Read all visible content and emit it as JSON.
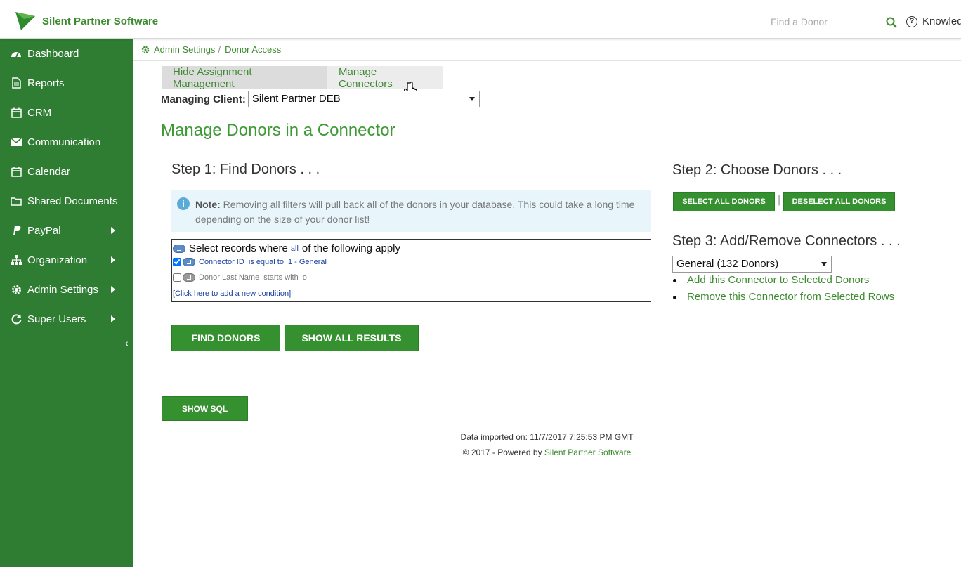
{
  "header": {
    "brand": "Silent Partner Software",
    "search_placeholder": "Find a Donor",
    "knowledge_label": "Knowledge"
  },
  "sidebar": {
    "items": [
      {
        "label": "Dashboard",
        "icon": "dashboard-icon",
        "has_submenu": false
      },
      {
        "label": "Reports",
        "icon": "document-icon",
        "has_submenu": false
      },
      {
        "label": "CRM",
        "icon": "calendar-icon",
        "has_submenu": false
      },
      {
        "label": "Communication",
        "icon": "envelope-icon",
        "has_submenu": false
      },
      {
        "label": "Calendar",
        "icon": "calendar-icon",
        "has_submenu": false
      },
      {
        "label": "Shared Documents",
        "icon": "folder-icon",
        "has_submenu": false
      },
      {
        "label": "PayPal",
        "icon": "paypal-icon",
        "has_submenu": true
      },
      {
        "label": "Organization",
        "icon": "sitemap-icon",
        "has_submenu": true
      },
      {
        "label": "Admin Settings",
        "icon": "gear-icon",
        "has_submenu": true
      },
      {
        "label": "Super Users",
        "icon": "refresh-icon",
        "has_submenu": true
      }
    ],
    "collapse_glyph": "‹"
  },
  "breadcrumb": {
    "items": [
      "Admin Settings",
      "Donor Access"
    ],
    "separator": "/"
  },
  "tabs": [
    "Hide Assignment Management",
    "Manage Connectors"
  ],
  "client": {
    "label": "Managing Client:",
    "value": "Silent Partner DEB"
  },
  "main": {
    "title": "Manage Donors in a Connector",
    "step1": "Step 1: Find Donors . . .",
    "step2": "Step 2: Choose Donors . . .",
    "step3": "Step 3: Add/Remove Connectors . . .",
    "note_label": "Note:",
    "note_text": "Removing all filters will pull back all of the donors in your database. This could take a long time depending on the size of your donor list!"
  },
  "filter": {
    "header_prefix": "Select records where",
    "header_mode": "all",
    "header_suffix": "of the following apply",
    "conditions": [
      {
        "checked": true,
        "field": "Connector ID",
        "op": "is equal to",
        "value": "1 - General"
      },
      {
        "checked": false,
        "field": "Donor Last Name",
        "op": "starts with",
        "value": "o"
      }
    ],
    "add_condition": "[Click here to add a new condition]"
  },
  "buttons": {
    "find": "FIND DONORS",
    "show_all": "SHOW ALL RESULTS",
    "select_all": "SELECT ALL DONORS",
    "deselect_all": "DESELECT ALL DONORS",
    "show_sql": "SHOW SQL",
    "divider": "|"
  },
  "connector": {
    "selected": "General (132 Donors)",
    "actions": [
      "Add this Connector to Selected Donors",
      "Remove this Connector from Selected Rows"
    ]
  },
  "footer": {
    "imported": "Data imported on: 11/7/2017 7:25:53 PM GMT",
    "copyright_prefix": "© 2017 - Powered by",
    "copyright_link": "Silent Partner Software"
  },
  "colors": {
    "brand_green": "#3d8b30",
    "sidebar_bg": "#2e7d32",
    "button_green": "#35912f",
    "note_bg": "#e8f6fc"
  }
}
